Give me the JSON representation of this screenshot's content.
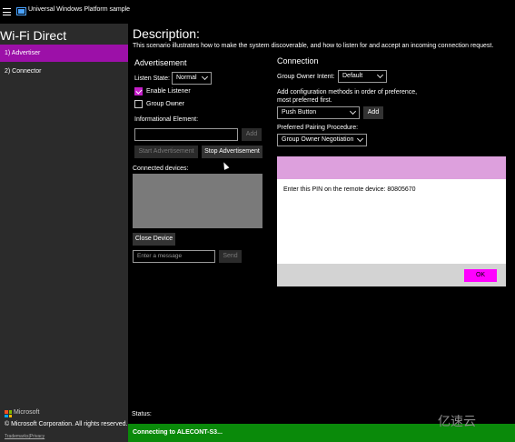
{
  "window": {
    "title": "Universal Windows Platform sample"
  },
  "sidebar": {
    "title": "Wi-Fi Direct",
    "items": [
      {
        "label": "1) Advertiser"
      },
      {
        "label": "2) Connector"
      }
    ],
    "brand": "Microsoft",
    "copyright": "© Microsoft Corporation. All rights reserved.",
    "footer_links": "Trademarks|Privacy"
  },
  "description": {
    "title": "Description:",
    "text": "This scenario illustrates how to make the system discoverable, and how to listen for and accept an incoming connection request."
  },
  "advertisement": {
    "heading": "Advertisement",
    "listen_state_label": "Listen State:",
    "listen_state_value": "Normal",
    "enable_listener_label": "Enable Listener",
    "enable_listener_checked": true,
    "group_owner_label": "Group Owner",
    "group_owner_checked": false,
    "info_element_label": "Informational Element:",
    "info_element_value": "",
    "add_label": "Add",
    "start_label": "Start Advertisement",
    "stop_label": "Stop Advertisement",
    "connected_devices_label": "Connected devices:",
    "close_device_label": "Close Device",
    "message_placeholder": "Enter a message",
    "send_label": "Send"
  },
  "connection": {
    "heading": "Connection",
    "group_owner_intent_label": "Group Owner Intent:",
    "group_owner_intent_value": "Default",
    "config_methods_label": "Add configuration methods in order of preference, most preferred first.",
    "config_method_value": "Push Button",
    "add_label": "Add",
    "pairing_procedure_label": "Preferred Pairing Procedure:",
    "pairing_procedure_value": "Group Owner Negotiation"
  },
  "pin_dialog": {
    "message": "Enter this PIN on the remote device: 80805670",
    "ok_label": "OK"
  },
  "status": {
    "label": "Status:",
    "message": "Connecting to ALECONT-S3..."
  },
  "watermark": "亿速云",
  "colors": {
    "accent": "#9c10a8",
    "checkbox": "#c51ec9",
    "dialog_header": "#dda0dd",
    "ok_button": "#ff00ff",
    "status_bar": "#0a8a0a"
  }
}
